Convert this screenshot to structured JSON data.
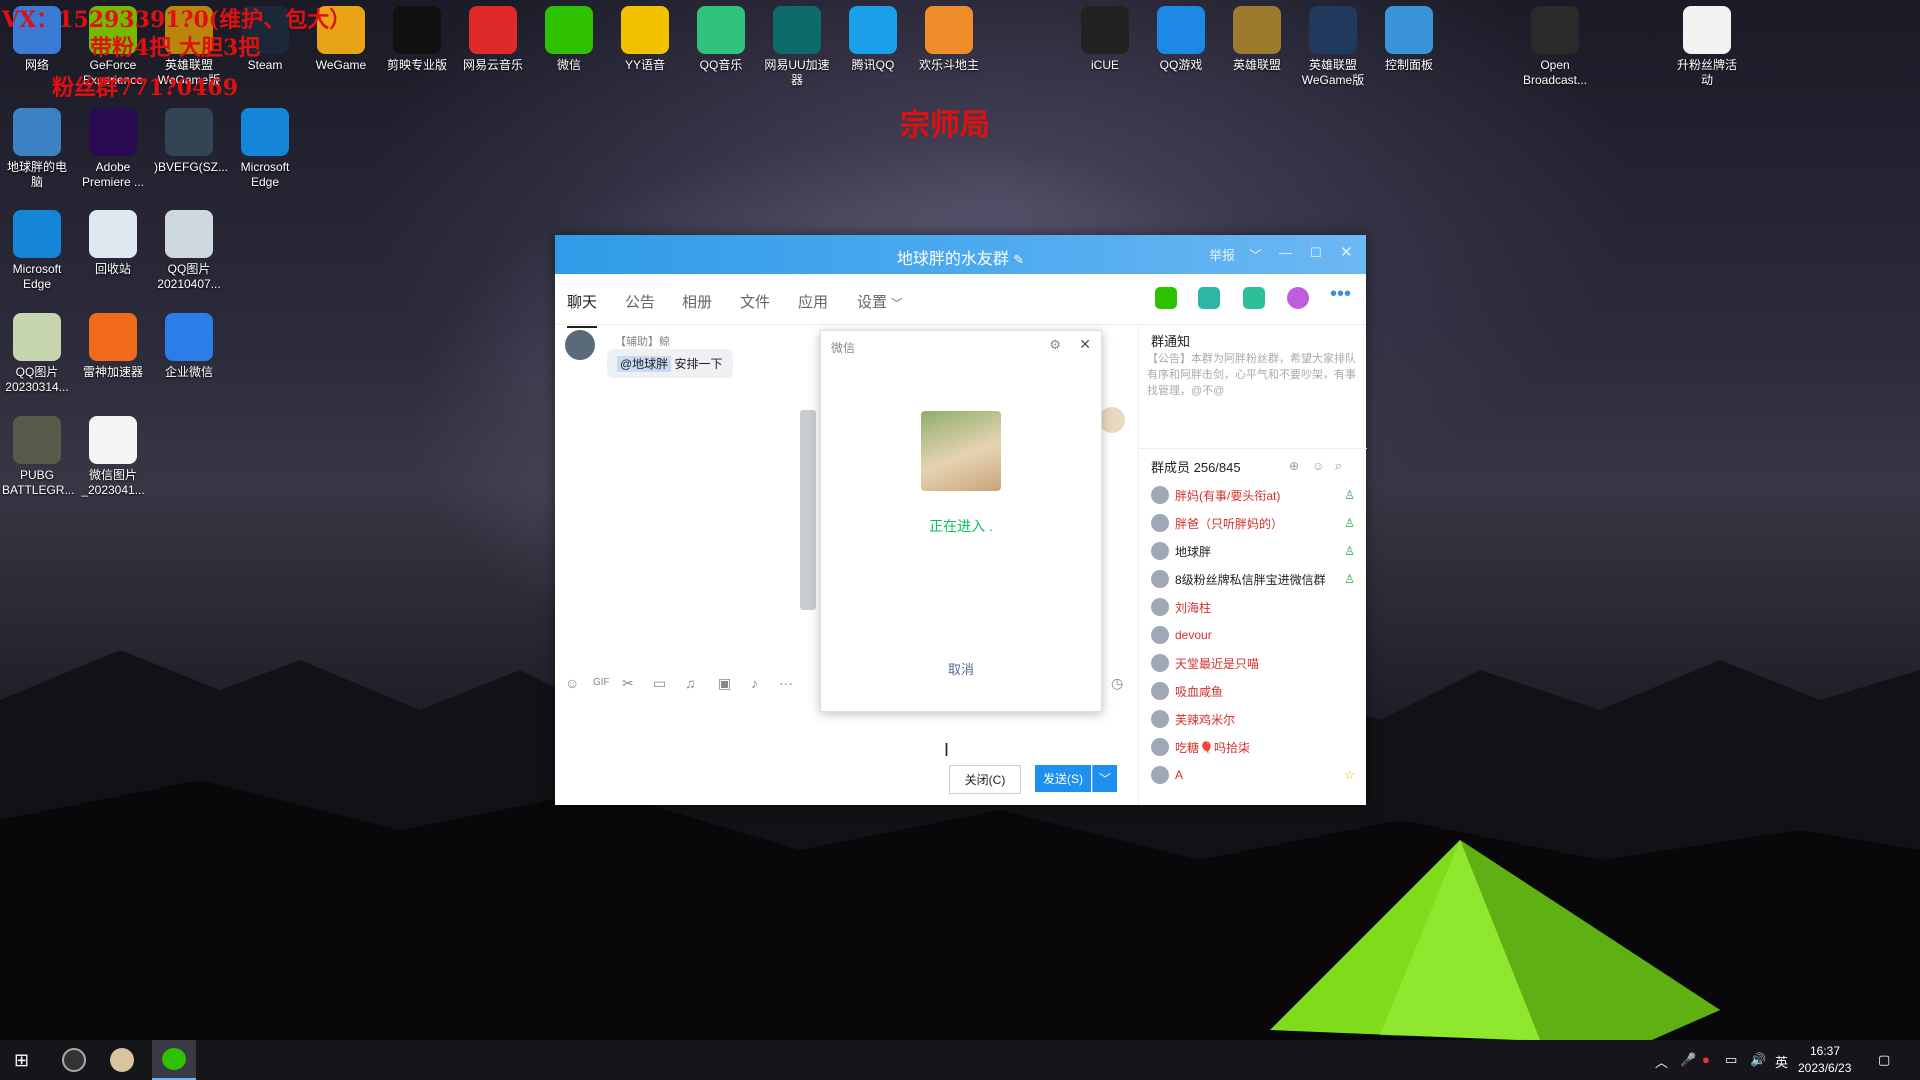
{
  "desktop": {
    "icons_row1": [
      {
        "label": "网络",
        "color": "#3a7bd5"
      },
      {
        "label": "GeForce Experience",
        "color": "#76b900"
      },
      {
        "label": "英雄联盟 WeGame版",
        "color": "#b8860b"
      },
      {
        "label": "Steam",
        "color": "#1b2838"
      },
      {
        "label": "WeGame",
        "color": "#e8a317"
      },
      {
        "label": "剪映专业版",
        "color": "#111111"
      },
      {
        "label": "网易云音乐",
        "color": "#e02a2a"
      },
      {
        "label": "微信",
        "color": "#2dc100"
      },
      {
        "label": "YY语音",
        "color": "#f2c200"
      },
      {
        "label": "QQ音乐",
        "color": "#31c27c"
      },
      {
        "label": "网易UU加速器",
        "color": "#0d6b6b"
      },
      {
        "label": "腾讯QQ",
        "color": "#1aa0e8"
      },
      {
        "label": "欢乐斗地主",
        "color": "#f08c2a"
      },
      {
        "label": "iCUE",
        "color": "#222222"
      },
      {
        "label": "QQ游戏",
        "color": "#1e88e5"
      },
      {
        "label": "英雄联盟",
        "color": "#9c7b2e"
      },
      {
        "label": "英雄联盟 WeGame版",
        "color": "#1f3a5c"
      },
      {
        "label": "控制面板",
        "color": "#3a95d8"
      },
      {
        "label": "Open Broadcast...",
        "color": "#2a2a2a"
      },
      {
        "label": "升粉丝牌活动",
        "color": "#f2f2f2"
      }
    ],
    "icons_col": [
      {
        "label": "地球胖的电脑",
        "color": "#3b82c4"
      },
      {
        "label": "Adobe Premiere ...",
        "color": "#2a0a52"
      },
      {
        "label": ")BVEFG(SZ...",
        "color": "#334455"
      },
      {
        "label": "Microsoft Edge",
        "color": "#1585d8"
      },
      {
        "label": "Microsoft Edge",
        "color": "#1585d8"
      },
      {
        "label": "回收站",
        "color": "#dfe8f0"
      },
      {
        "label": "QQ图片 20210407...",
        "color": "#cfd8dc"
      },
      {
        "label": "QQ图片 20230314...",
        "color": "#c8d6b0"
      },
      {
        "label": "雷神加速器",
        "color": "#f26b1d"
      },
      {
        "label": "企业微信",
        "color": "#2b7de9"
      },
      {
        "label": "PUBG BATTLEGR...",
        "color": "#5a5a4a"
      },
      {
        "label": "微信图片 _2023041...",
        "color": "#f5f5f5"
      }
    ],
    "overlay": {
      "line1": "VX：15293391?0(维护、包大）",
      "line2": "带粉4把 大胆3把",
      "line3": "粉丝群771?0469",
      "title": "宗师局"
    }
  },
  "window": {
    "title": "地球胖的水友群",
    "report": "举报",
    "tabs": [
      "聊天",
      "公告",
      "相册",
      "文件",
      "应用",
      "设置"
    ],
    "message": {
      "sender": "【辅助】鲸",
      "mention": "@地球胖",
      "text": "安排一下"
    },
    "close_label": "关闭(C)",
    "send_label": "发送(S)",
    "notice_title": "群通知",
    "notice_text": "【公告】本群为阿胖粉丝群，希望大家排队有序和阿胖击剑，心平气和不要吵架，有事找管理，@不@",
    "members_title": "群成员 256/845",
    "members": [
      {
        "name": "胖妈(有事/要头衔at)",
        "color": "#d0312d",
        "role": "admin"
      },
      {
        "name": "胖爸（只听胖妈的）",
        "color": "#d0312d",
        "role": "admin"
      },
      {
        "name": "地球胖",
        "color": "#222222",
        "role": "admin"
      },
      {
        "name": "8级粉丝牌私信胖宝进微信群",
        "color": "#222222",
        "role": "admin"
      },
      {
        "name": "刘海柱",
        "color": "#d0312d",
        "role": ""
      },
      {
        "name": "devour",
        "color": "#d0312d",
        "role": ""
      },
      {
        "name": "天堂最近是只喵",
        "color": "#d0312d",
        "role": ""
      },
      {
        "name": "吸血咸鱼",
        "color": "#d0312d",
        "role": ""
      },
      {
        "name": "芙辣鸡米尔",
        "color": "#d0312d",
        "role": ""
      },
      {
        "name": "吃糖🎈吗拾柒",
        "color": "#d0312d",
        "role": ""
      },
      {
        "name": "A",
        "color": "#d0312d",
        "role": "owner"
      }
    ]
  },
  "dialog": {
    "title": "微信",
    "status": "正在进入 .",
    "cancel": "取消"
  },
  "taskbar": {
    "ime": "英",
    "time": "16:37",
    "date": "2023/6/23"
  }
}
